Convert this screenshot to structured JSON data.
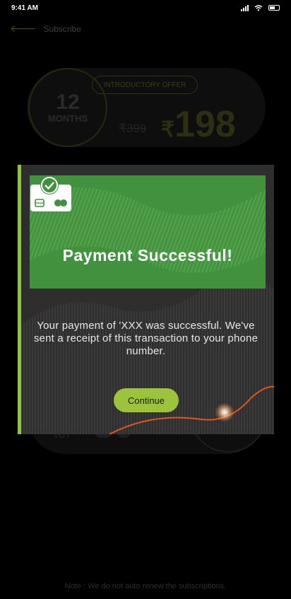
{
  "status_bar": {
    "time": "9:41 AM"
  },
  "header": {
    "title": "Subscribe"
  },
  "plan_top": {
    "months_number": "12",
    "months_label": "MONTHS",
    "offer_badge": "INTRODUCTORY OFFER",
    "old_price": "₹399",
    "currency": "₹",
    "price": "198"
  },
  "plan_bottom": {
    "old_price": "₹87",
    "price": "30"
  },
  "modal": {
    "title": "Payment Successful!",
    "message": "Your payment of 'XXX was successful. We've sent a receipt of this transaction to your phone number.",
    "continue_label": "Continue",
    "accent_color": "#8fc43f",
    "banner_color": "#41913f",
    "button_color": "#9bc33b"
  },
  "footer": {
    "note": "Note : We do not auto renew the subscriptions."
  }
}
